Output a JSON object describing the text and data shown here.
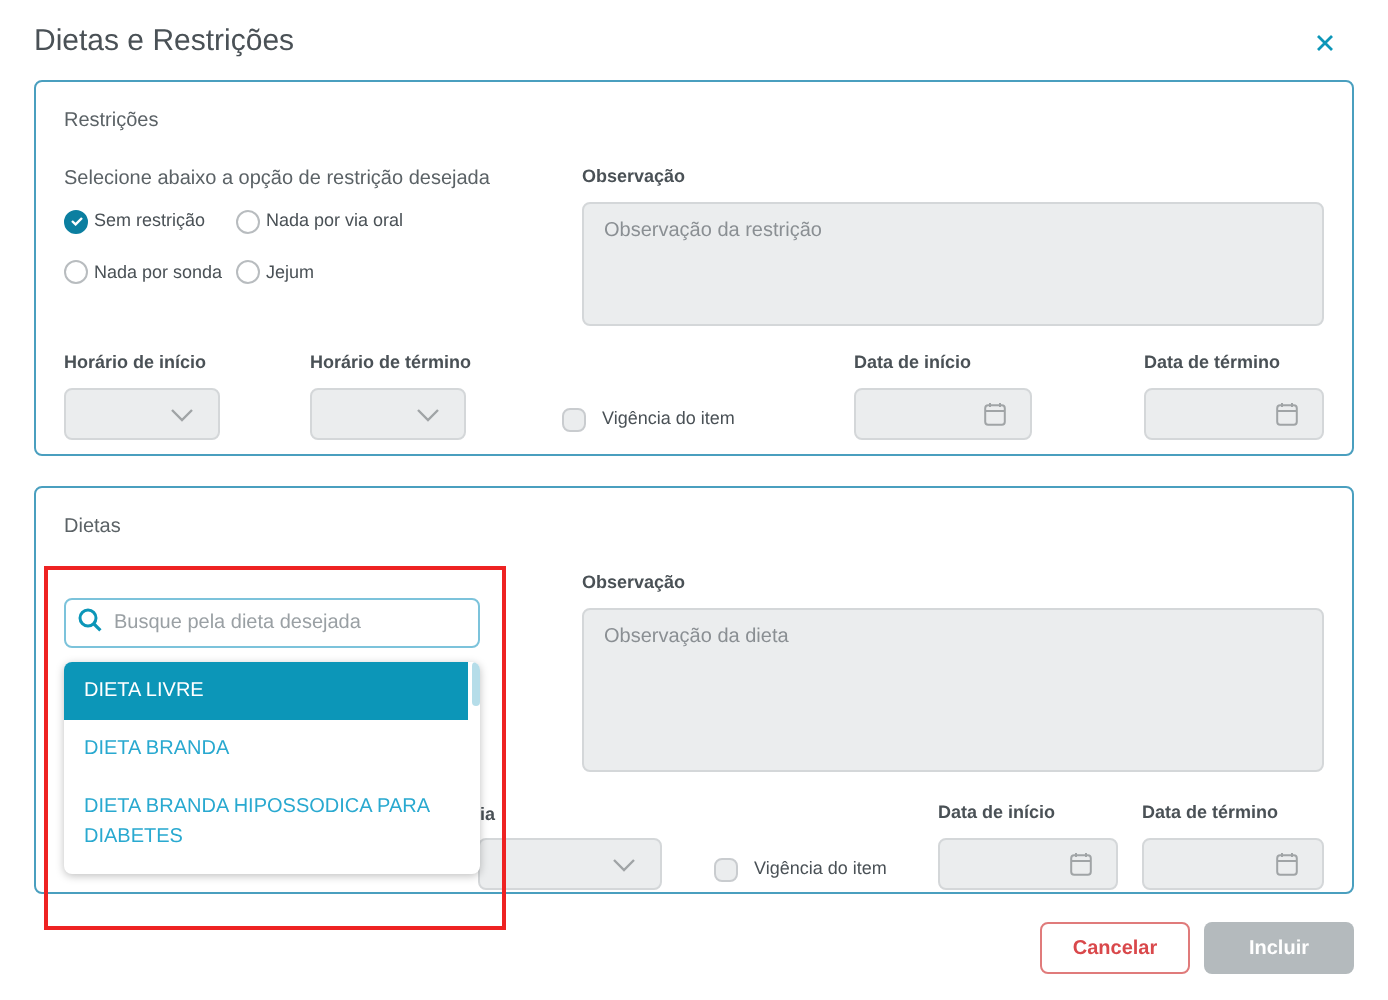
{
  "dialog": {
    "title": "Dietas e Restrições"
  },
  "restrictions": {
    "title": "Restrições",
    "prompt": "Selecione abaixo a opção de restrição desejada",
    "options": [
      {
        "label": "Sem restrição",
        "selected": true
      },
      {
        "label": "Nada por via oral",
        "selected": false
      },
      {
        "label": "Nada por sonda",
        "selected": false
      },
      {
        "label": "Jejum",
        "selected": false
      }
    ],
    "observation": {
      "label": "Observação",
      "placeholder": "Observação da restrição"
    },
    "start_time": {
      "label": "Horário de início"
    },
    "end_time": {
      "label": "Horário de término"
    },
    "validity": {
      "label": "Vigência do item",
      "checked": false
    },
    "start_date": {
      "label": "Data de início"
    },
    "end_date": {
      "label": "Data de término"
    }
  },
  "diets": {
    "title": "Dietas",
    "search": {
      "placeholder": "Busque pela dieta desejada"
    },
    "results": [
      {
        "label": "DIETA LIVRE",
        "selected": true
      },
      {
        "label": "DIETA BRANDA",
        "selected": false
      },
      {
        "label": "DIETA BRANDA HIPOSSODICA PARA DIABETES",
        "selected": false
      }
    ],
    "observation": {
      "label": "Observação",
      "placeholder": "Observação da dieta"
    },
    "covered_field": {
      "label": "ia"
    },
    "validity": {
      "label": "Vigência do item",
      "checked": false
    },
    "start_date": {
      "label": "Data de início"
    },
    "end_date": {
      "label": "Data de término"
    }
  },
  "buttons": [
    {
      "label": "Cancelar",
      "kind": "secondary",
      "disabled": false
    },
    {
      "label": "Incluir",
      "kind": "primary",
      "disabled": true
    }
  ]
}
